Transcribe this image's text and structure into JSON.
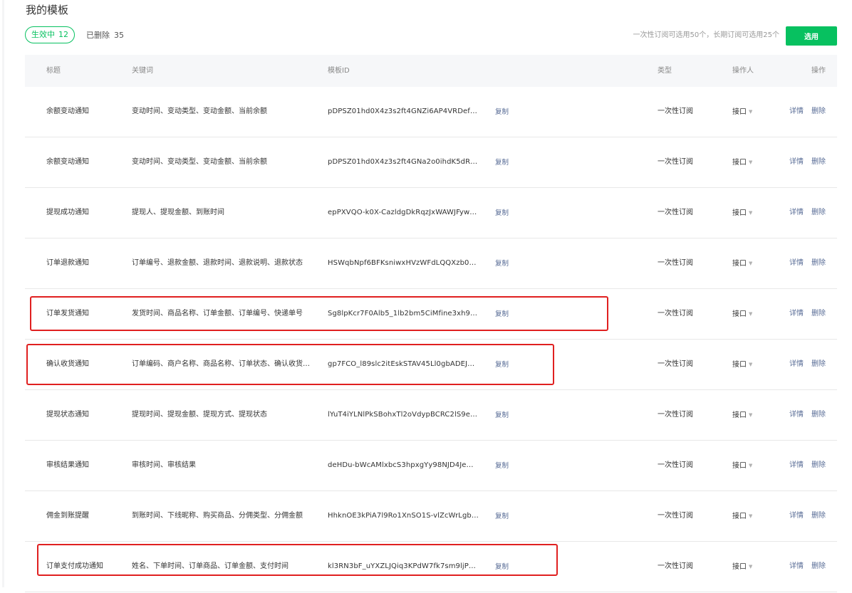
{
  "page": {
    "title": "我的模板"
  },
  "filters": {
    "active_label": "生效中",
    "active_count": "12",
    "deleted_label": "已删除",
    "deleted_count": "35"
  },
  "quota_text": "一次性订阅可选用50个，长期订阅可选用25个",
  "select_button": "选用",
  "columns": {
    "title": "标题",
    "keywords": "关键词",
    "template_id": "模板ID",
    "type": "类型",
    "operator": "操作人",
    "actions": "操作"
  },
  "rows": [
    {
      "title": "余额变动通知",
      "keywords": "变动时间、变动类型、变动金额、当前余额",
      "template_id": "pDPSZ01hd0X4z3s2ft4GNZi6AP4VRDef…",
      "copy": "复制",
      "type": "一次性订阅",
      "operator": "接口",
      "detail": "详情",
      "delete": "删除"
    },
    {
      "title": "余额变动通知",
      "keywords": "变动时间、变动类型、变动金额、当前余额",
      "template_id": "pDPSZ01hd0X4z3s2ft4GNa2o0ihdK5dR…",
      "copy": "复制",
      "type": "一次性订阅",
      "operator": "接口",
      "detail": "详情",
      "delete": "删除"
    },
    {
      "title": "提现成功通知",
      "keywords": "提现人、提现金额、到账时间",
      "template_id": "epPXVQO-k0X-CazldgDkRqzJxWAWJFyw…",
      "copy": "复制",
      "type": "一次性订阅",
      "operator": "接口",
      "detail": "详情",
      "delete": "删除"
    },
    {
      "title": "订单退款通知",
      "keywords": "订单编号、退款金额、退款时间、退款说明、退款状态",
      "template_id": "HSWqbNpf6BFKsniwxHVzWFdLQQXzb0…",
      "copy": "复制",
      "type": "一次性订阅",
      "operator": "接口",
      "detail": "详情",
      "delete": "删除"
    },
    {
      "title": "订单发货通知",
      "keywords": "发货时间、商品名称、订单金额、订单编号、快递单号",
      "template_id": "Sg8lpKcr7F0Alb5_1lb2bm5CiMfine3xh9…",
      "copy": "复制",
      "type": "一次性订阅",
      "operator": "接口",
      "detail": "详情",
      "delete": "删除"
    },
    {
      "title": "确认收货通知",
      "keywords": "订单编码、商户名称、商品名称、订单状态、确认收货…",
      "template_id": "gp7FCO_l89slc2itEskSTAV45Ll0gbADEJ…",
      "copy": "复制",
      "type": "一次性订阅",
      "operator": "接口",
      "detail": "详情",
      "delete": "删除"
    },
    {
      "title": "提现状态通知",
      "keywords": "提现时间、提现金额、提现方式、提现状态",
      "template_id": "lYuT4iYLNlPkSBohxTl2oVdypBCRC2lS9e…",
      "copy": "复制",
      "type": "一次性订阅",
      "operator": "接口",
      "detail": "详情",
      "delete": "删除"
    },
    {
      "title": "审核结果通知",
      "keywords": "审核时间、审核结果",
      "template_id": "deHDu-bWcAMlxbcS3hpxgYy98NJD4Je…",
      "copy": "复制",
      "type": "一次性订阅",
      "operator": "接口",
      "detail": "详情",
      "delete": "删除"
    },
    {
      "title": "佣金到账提醒",
      "keywords": "到账时间、下线昵称、购买商品、分佣类型、分佣金额",
      "template_id": "HhknOE3kPiA7l9Ro1XnSO1S-vlZcWrLgb…",
      "copy": "复制",
      "type": "一次性订阅",
      "operator": "接口",
      "detail": "详情",
      "delete": "删除"
    },
    {
      "title": "订单支付成功通知",
      "keywords": "姓名、下单时间、订单商品、订单金额、支付时间",
      "template_id": "kl3RN3bF_uYXZLJQiq3KPdW7fk7sm9ljP…",
      "copy": "复制",
      "type": "一次性订阅",
      "operator": "接口",
      "detail": "详情",
      "delete": "删除"
    }
  ],
  "colors": {
    "accent": "#07c160",
    "link": "#576b95",
    "highlight": "#e02020"
  }
}
